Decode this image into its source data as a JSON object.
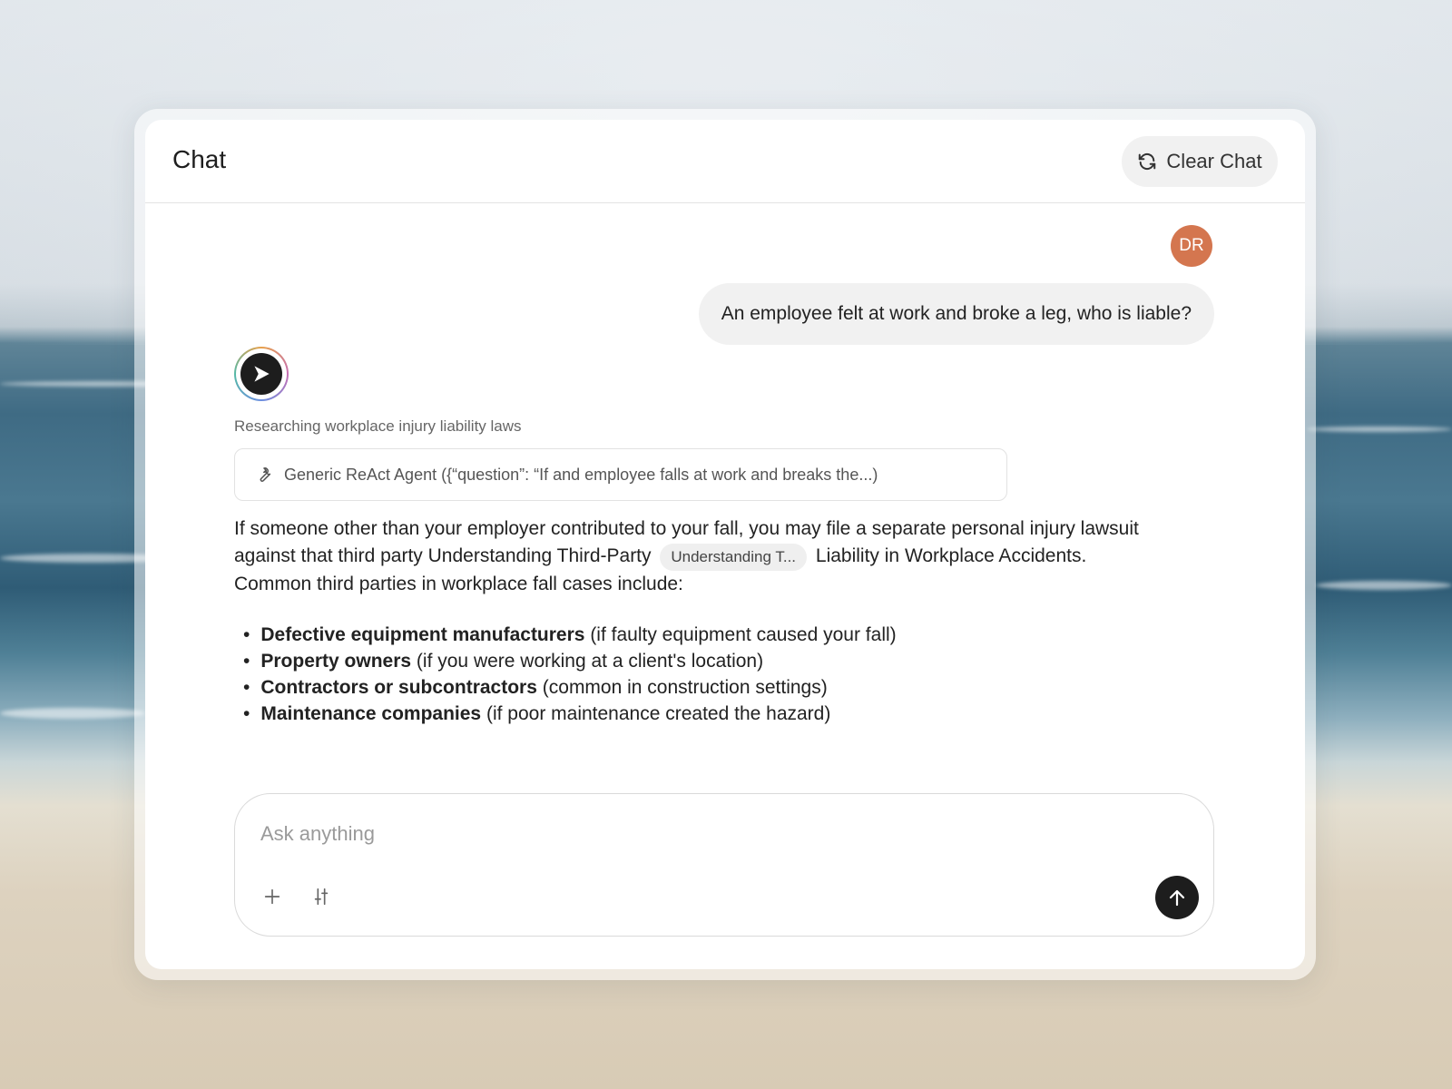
{
  "header": {
    "title": "Chat",
    "clear_label": "Clear Chat"
  },
  "user": {
    "initials": "DR",
    "message": "An employee felt at work and broke a leg, who is liable?"
  },
  "assistant": {
    "status": "Researching workplace injury liability laws",
    "tool_call": "Generic ReAct Agent ({“question”: “If and employee falls at work and breaks the...)",
    "answer_part1": "If someone other than your employer contributed to your fall, you may file a separate personal injury lawsuit against that third party Understanding Third-Party",
    "citation_chip": "Understanding T...",
    "answer_part2": "Liability in Workplace Accidents. Common third parties in workplace fall cases include:",
    "bullets": [
      {
        "bold": "Defective equipment manufacturers",
        "rest": "(if faulty equipment caused your fall)"
      },
      {
        "bold": "Property owners",
        "rest": "(if you were working at a client's location)"
      },
      {
        "bold": "Contractors or subcontractors",
        "rest": "(common in construction settings)"
      },
      {
        "bold": "Maintenance companies",
        "rest": "(if poor maintenance created the hazard)"
      }
    ]
  },
  "composer": {
    "placeholder": "Ask anything"
  },
  "colors": {
    "avatar": "#d4764f",
    "send_button": "#1d1d1d"
  },
  "icons": [
    "refresh-icon",
    "wrench-icon",
    "plus-icon",
    "sliders-icon",
    "arrow-up-icon",
    "assistant-logo-icon"
  ]
}
